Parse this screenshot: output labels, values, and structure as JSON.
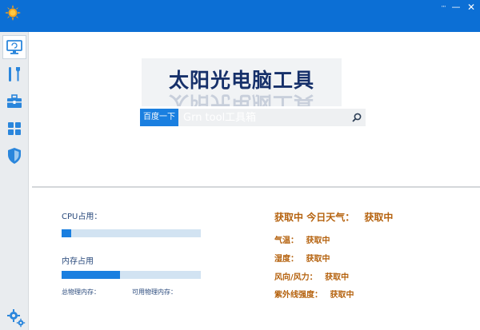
{
  "window": {
    "menu_glyph": "···",
    "minimize_glyph": "—",
    "close_glyph": "✕"
  },
  "sidebar": {
    "items": [
      {
        "name": "monitor",
        "icon": "monitor-icon",
        "active": true
      },
      {
        "name": "tools",
        "icon": "tools-icon"
      },
      {
        "name": "toolbox",
        "icon": "toolbox-icon"
      },
      {
        "name": "apps",
        "icon": "apps-grid-icon"
      },
      {
        "name": "security",
        "icon": "shield-icon"
      }
    ],
    "settings_icon": "settings-gears-icon"
  },
  "banner": {
    "title": "太阳光电脑工具"
  },
  "search": {
    "button_label": "百度一下",
    "placeholder": "Grn tool工具箱"
  },
  "stats": {
    "cpu_label": "CPU占用：",
    "cpu_usage": 0.07,
    "mem_label": "内存占用",
    "mem_usage": 0.42,
    "total_mem_label": "总物理内存：",
    "avail_mem_label": "可用物理内存："
  },
  "weather": {
    "location": "获取中",
    "today_label": "今日天气：",
    "today_value": "获取中",
    "temp_label": "气温：",
    "temp_value": "获取中",
    "humidity_label": "湿度：",
    "humidity_value": "获取中",
    "wind_label": "风向/风力：",
    "wind_value": "获取中",
    "uv_label": "紫外线强度：",
    "uv_value": "获取中"
  },
  "colors": {
    "accent": "#0c6fd5",
    "button": "#1a7fe0",
    "weather_text": "#b5620e",
    "label_text": "#2a4a7c"
  }
}
